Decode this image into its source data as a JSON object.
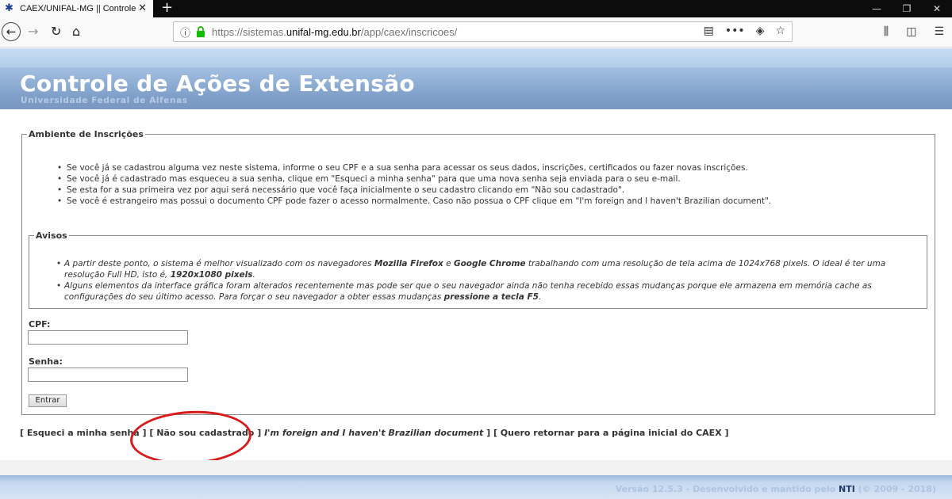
{
  "browser": {
    "tab": {
      "favicon": "unifal-star-icon",
      "title": "CAEX/UNIFAL-MG || Controle",
      "title_fade": " d"
    },
    "url": {
      "prefix": "https://sistemas.",
      "host": "unifal-mg.edu.br",
      "path": "/app/caex/inscricoes/"
    },
    "accent_color": "#12bc00"
  },
  "header": {
    "title": "Controle de Ações de Extensão",
    "subtitle": "Universidade Federal de Alfenas"
  },
  "main": {
    "legend": "Ambiente de Inscrições",
    "items": [
      "Se você já se cadastrou alguma vez neste sistema, informe o seu CPF e a sua senha para acessar os seus dados, inscrições, certificados ou fazer novas inscrições.",
      "Se você já é cadastrado mas esqueceu a sua senha, clique em \"Esqueci a minha senha\" para que uma nova senha seja enviada para o seu e-mail.",
      "Se esta for a sua primeira vez por aqui será necessário que você faça inicialmente o seu cadastro clicando em \"Não sou cadastrado\".",
      "Se você é estrangeiro mas possui o documento CPF pode fazer o acesso normalmente. Caso não possua o CPF clique em \"I'm foreign and I haven't Brazilian document\"."
    ]
  },
  "avisos": {
    "legend": "Avisos",
    "item1": {
      "a": "A partir deste ponto, o sistema é melhor visualizado com os navegadores ",
      "b1": "Mozilla Firefox",
      "c": " e ",
      "b2": "Google Chrome",
      "d": " trabalhando com uma resolução de tela acima de 1024x768 pixels. O ideal é ter uma resolução Full HD, isto é, ",
      "b3": "1920x1080 pixels",
      "e": "."
    },
    "item2": {
      "a": "Alguns elementos da interface gráfica foram alterados recentemente mas pode ser que o seu navegador ainda não tenha recebido essas mudanças porque ele armazena em memória cache as configurações do seu último acesso. Para forçar o seu navegador a obter essas mudanças ",
      "b": "pressione a tecla F5",
      "c": "."
    }
  },
  "form": {
    "cpf_label": "CPF:",
    "cpf_value": "",
    "senha_label": "Senha:",
    "senha_value": "",
    "submit_label": "Entrar"
  },
  "links": {
    "forgot": "[ Esqueci a minha senha ]",
    "not_registered": "[ Não sou cadastrado ]",
    "foreign": "I'm foreign and I haven't Brazilian document",
    "foreign_close": " ]",
    "home": "[ Quero retornar para a página inicial do CAEX ]"
  },
  "footer": {
    "prefix": "Versão 12.5.3 - Desenvolvido e mantido pelo ",
    "nti": "NTI",
    "suffix": " (© 2009 - 2018)"
  },
  "colors": {
    "highlight_ring": "#d91a1a",
    "header_band": "#7f9fc9"
  }
}
